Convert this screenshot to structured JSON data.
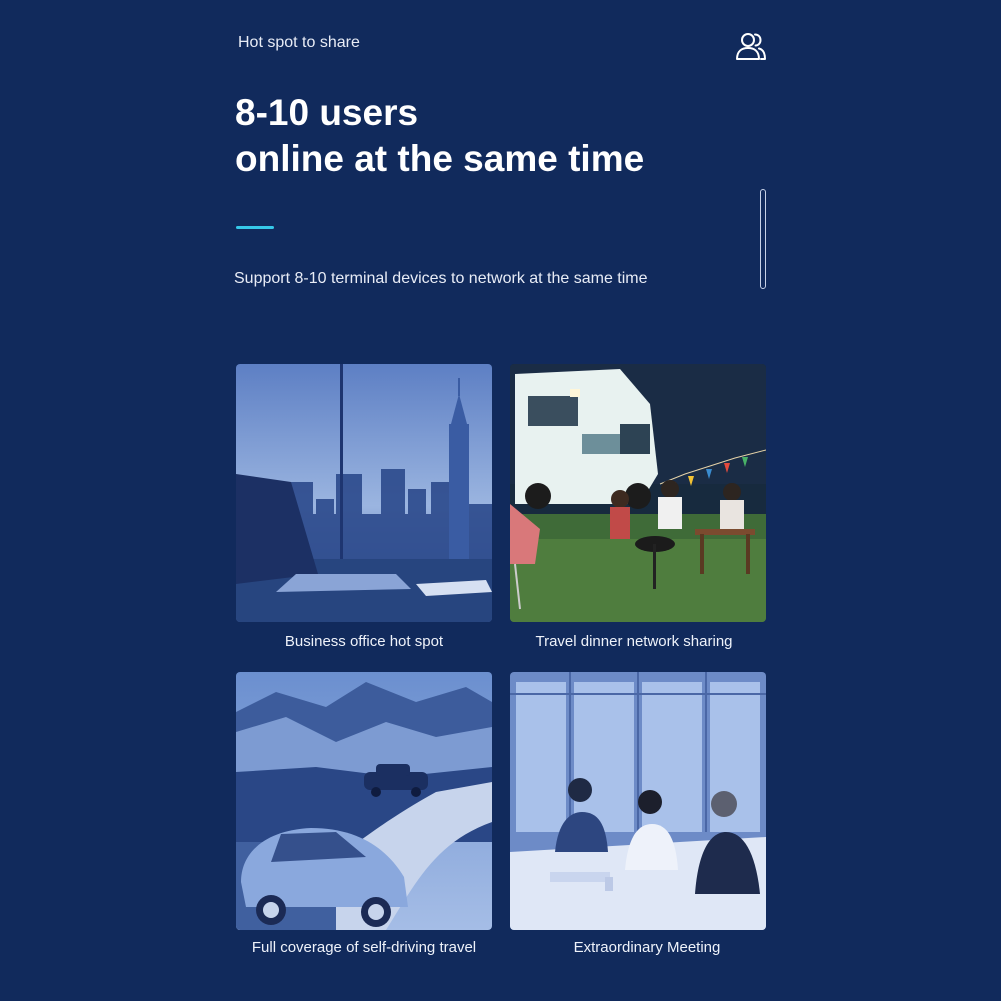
{
  "header": {
    "eyebrow": "Hot spot to share",
    "icon": "users-icon"
  },
  "hero": {
    "headline_line1": "8-10 users",
    "headline_line2": "online at the same time",
    "subtext": "Support 8-10 terminal devices to network at the same time",
    "accent_color": "#36c8e8"
  },
  "scenarios": [
    {
      "caption": "Business office hot spot"
    },
    {
      "caption": "Travel dinner network sharing"
    },
    {
      "caption": "Full coverage of self-driving travel"
    },
    {
      "caption": "Extraordinary Meeting"
    }
  ],
  "colors": {
    "background": "#112a5c",
    "text": "#ffffff"
  }
}
